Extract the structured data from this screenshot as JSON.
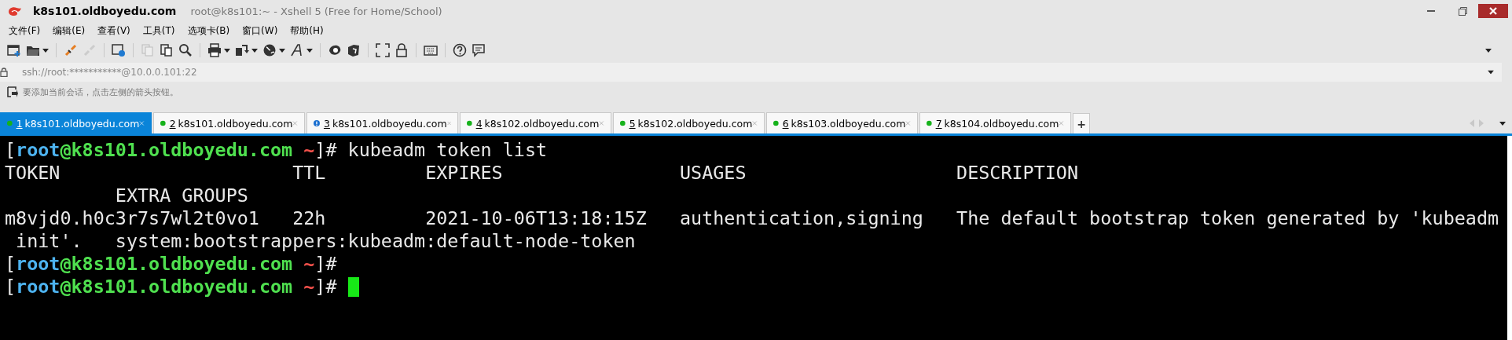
{
  "window": {
    "title": "k8s101.oldboyedu.com",
    "subtitle": "root@k8s101:~ - Xshell 5 (Free for Home/School)"
  },
  "menu": [
    "文件(F)",
    "编辑(E)",
    "查看(V)",
    "工具(T)",
    "选项卡(B)",
    "窗口(W)",
    "帮助(H)"
  ],
  "address": {
    "value": "ssh://root:***********@10.0.0.101:22"
  },
  "hint": "要添加当前会话，点击左侧的箭头按钮。",
  "tabs": [
    {
      "number": "1",
      "label": "k8s101.oldboyedu.com",
      "kind": "connected",
      "selected": true
    },
    {
      "number": "2",
      "label": "k8s101.oldboyedu.com",
      "kind": "connected",
      "selected": false
    },
    {
      "number": "3",
      "label": "k8s101.oldboyedu.com",
      "kind": "alert",
      "selected": false
    },
    {
      "number": "4",
      "label": "k8s102.oldboyedu.com",
      "kind": "connected",
      "selected": false
    },
    {
      "number": "5",
      "label": "k8s102.oldboyedu.com",
      "kind": "connected",
      "selected": false
    },
    {
      "number": "6",
      "label": "k8s103.oldboyedu.com",
      "kind": "connected",
      "selected": false
    },
    {
      "number": "7",
      "label": "k8s104.oldboyedu.com",
      "kind": "connected",
      "selected": false
    }
  ],
  "new_tab": "+",
  "terminal": {
    "cursor": true,
    "lines": [
      {
        "segments": [
          {
            "kind": "plain",
            "text": "["
          },
          {
            "kind": "user",
            "text": "root"
          },
          {
            "kind": "host",
            "text": "@k8s101.oldboyedu.com"
          },
          {
            "kind": "dir",
            "text": " ~"
          },
          {
            "kind": "plain",
            "text": "]# kubeadm token list"
          }
        ]
      },
      {
        "segments": [
          {
            "kind": "plain",
            "text": "TOKEN                     TTL         EXPIRES                USAGES                   DESCRIPTION"
          }
        ]
      },
      {
        "segments": [
          {
            "kind": "plain",
            "text": "          EXTRA GROUPS"
          }
        ]
      },
      {
        "segments": [
          {
            "kind": "plain",
            "text": "m8vjd0.h0c3r7s7wl2t0vo1   22h         2021-10-06T13:18:15Z   authentication,signing   The default bootstrap token generated by 'kubeadm"
          }
        ]
      },
      {
        "segments": [
          {
            "kind": "plain",
            "text": " init'.   system:bootstrappers:kubeadm:default-node-token"
          }
        ]
      },
      {
        "segments": [
          {
            "kind": "plain",
            "text": "["
          },
          {
            "kind": "user",
            "text": "root"
          },
          {
            "kind": "host",
            "text": "@k8s101.oldboyedu.com"
          },
          {
            "kind": "dir",
            "text": " ~"
          },
          {
            "kind": "plain",
            "text": "]#"
          }
        ]
      },
      {
        "segments": [
          {
            "kind": "plain",
            "text": "["
          },
          {
            "kind": "user",
            "text": "root"
          },
          {
            "kind": "host",
            "text": "@k8s101.oldboyedu.com"
          },
          {
            "kind": "dir",
            "text": " ~"
          },
          {
            "kind": "plain",
            "text": "]# "
          }
        ]
      }
    ]
  }
}
